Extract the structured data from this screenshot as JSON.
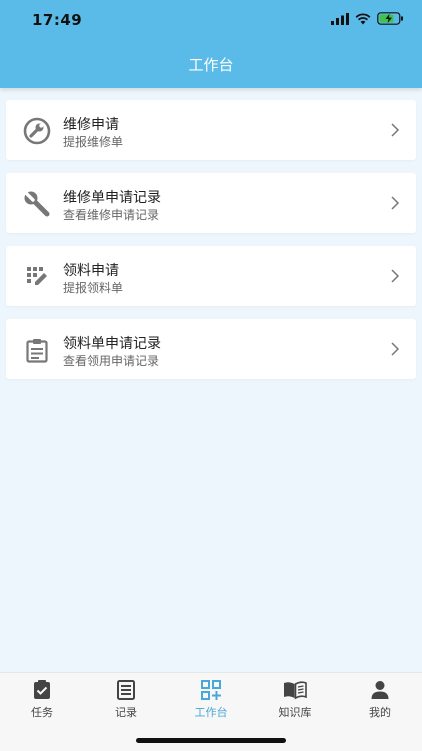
{
  "status_bar": {
    "time": "17:49"
  },
  "header": {
    "title": "工作台"
  },
  "menu": [
    {
      "title": "维修申请",
      "subtitle": "提报维修单",
      "icon": "wrench-circle-icon"
    },
    {
      "title": "维修单申请记录",
      "subtitle": "查看维修申请记录",
      "icon": "wrench-icon"
    },
    {
      "title": "领料申请",
      "subtitle": "提报领料单",
      "icon": "edit-grid-icon"
    },
    {
      "title": "领料单申请记录",
      "subtitle": "查看领用申请记录",
      "icon": "clipboard-icon"
    }
  ],
  "tabbar": {
    "active_color": "#4aa8d8",
    "items": [
      {
        "label": "任务",
        "icon": "task-check-icon",
        "active": false
      },
      {
        "label": "记录",
        "icon": "record-icon",
        "active": false
      },
      {
        "label": "工作台",
        "icon": "qr-workbench-icon",
        "active": true
      },
      {
        "label": "知识库",
        "icon": "book-icon",
        "active": false
      },
      {
        "label": "我的",
        "icon": "person-icon",
        "active": false
      }
    ]
  },
  "colors": {
    "header_bg": "#5bbbe8",
    "page_bg": "#eef6fd",
    "icon_gray": "#777777"
  }
}
